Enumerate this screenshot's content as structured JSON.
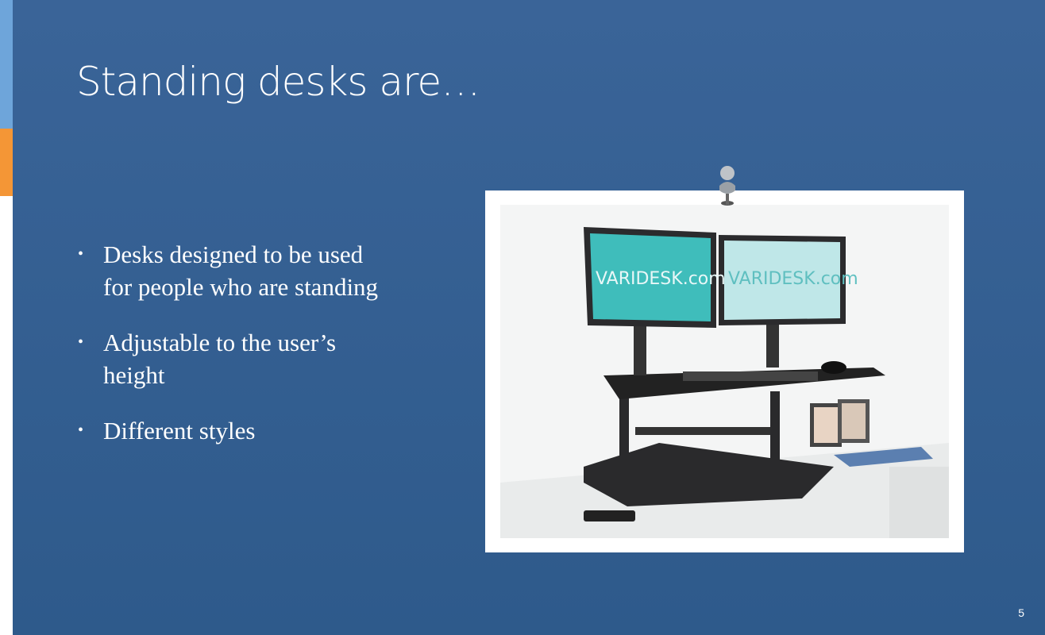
{
  "slide": {
    "title": "Standing desks are…",
    "bullets": [
      "Desks designed to be used for people who are standing",
      "Adjustable to the user’s height",
      "Different styles"
    ],
    "page_number": "5",
    "photo": {
      "screen_text_left": "VARIDESK.com",
      "screen_text_right": "VARIDESK.com"
    }
  },
  "colors": {
    "background": "#3a6498",
    "accent_blue": "#6ea5da",
    "accent_orange": "#f49636"
  }
}
